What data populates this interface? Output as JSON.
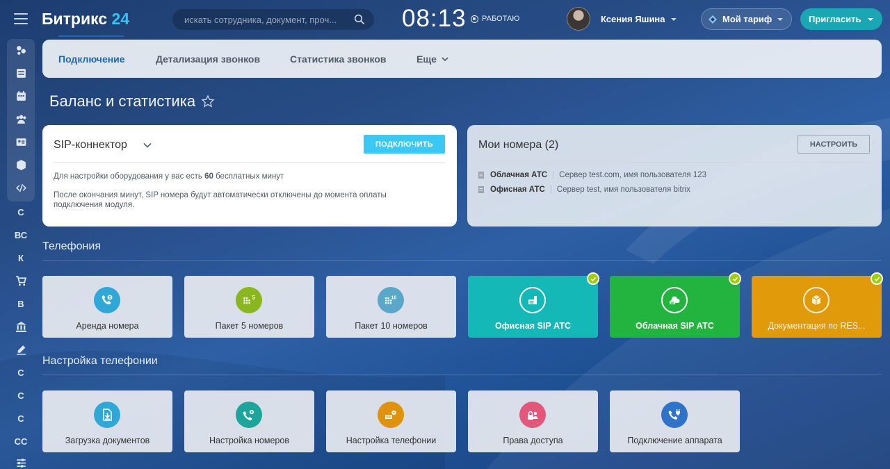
{
  "sidebar": {
    "items": [
      {
        "icon": "activity-icon"
      },
      {
        "icon": "tasks-icon"
      },
      {
        "icon": "calendar-icon"
      },
      {
        "icon": "group-icon"
      },
      {
        "icon": "contact-card-icon"
      },
      {
        "icon": "box-icon"
      },
      {
        "icon": "code-icon"
      },
      {
        "label": "С"
      },
      {
        "label": "ВС"
      },
      {
        "label": "К"
      },
      {
        "icon": "cart-icon"
      },
      {
        "label": "В"
      },
      {
        "icon": "bank-icon"
      },
      {
        "icon": "sign-icon"
      },
      {
        "label": "С"
      },
      {
        "label": "С"
      },
      {
        "label": "С"
      },
      {
        "label": "СС"
      },
      {
        "icon": "sliders-icon"
      }
    ]
  },
  "header": {
    "logo_main": "Битрикс",
    "logo_num": "24",
    "search_placeholder": "искать сотрудника, документ, проч...",
    "clock": "08:13",
    "work_status": "РАБОТАЮ",
    "user_name": "Ксения Яшина",
    "tariff_label": "Мой тариф",
    "invite_label": "Пригласить"
  },
  "tabs": [
    {
      "label": "Подключение"
    },
    {
      "label": "Детализация звонков"
    },
    {
      "label": "Статистика звонков"
    },
    {
      "label": "Еще"
    }
  ],
  "page_title": "Баланс и статистика",
  "sip_card": {
    "title": "SIP-коннектор",
    "button": "ПОДКЛЮЧИТЬ",
    "text1_pre": "Для настройки оборудования у вас есть ",
    "text1_bold": "60",
    "text1_post": " бесплатных минут",
    "text2": "После окончания минут, SIP номера будут автоматически отключены до момента оплаты подключения модуля."
  },
  "numbers_card": {
    "title": "Мои номера (2)",
    "button": "НАСТРОИТЬ",
    "rows": [
      {
        "name": "Облачная АТС",
        "desc": "Сервер test.com, имя пользователя 123"
      },
      {
        "name": "Офисная АТС",
        "desc": "Сервер test, имя пользователя bitrix"
      }
    ]
  },
  "sections": {
    "telephony": "Телефония",
    "telephony_settings": "Настройка телефонии"
  },
  "telephony_tiles": [
    {
      "label": "Аренда номера",
      "icon": "phone-dollar-icon",
      "color": "#2fa8d8"
    },
    {
      "label": "Пакет 5 номеров",
      "icon": "dialpad-5-icon",
      "color": "#8bb71e"
    },
    {
      "label": "Пакет 10 номеров",
      "icon": "dialpad-10-icon",
      "color": "#5aa7c9"
    },
    {
      "label": "Офисная SIP АТС",
      "icon": "office-pbx-icon",
      "color": "#14b8b6",
      "checked": true
    },
    {
      "label": "Облачная SIP АТС",
      "icon": "cloud-pbx-icon",
      "color": "#23b33f",
      "checked": true
    },
    {
      "label": "Документация по RES...",
      "icon": "box-doc-icon",
      "color": "#e09a0a",
      "checked": true
    }
  ],
  "settings_tiles": [
    {
      "label": "Загрузка документов",
      "icon": "upload-doc-icon",
      "color": "#2fa8d8"
    },
    {
      "label": "Настройка номеров",
      "icon": "phone-gear-icon",
      "color": "#1ba59b"
    },
    {
      "label": "Настройка телефонии",
      "icon": "phone-settings-icon",
      "color": "#e0930a"
    },
    {
      "label": "Права доступа",
      "icon": "lock-user-icon",
      "color": "#e4577a"
    },
    {
      "label": "Подключение аппарата",
      "icon": "plug-phone-icon",
      "color": "#2f72c9"
    }
  ]
}
